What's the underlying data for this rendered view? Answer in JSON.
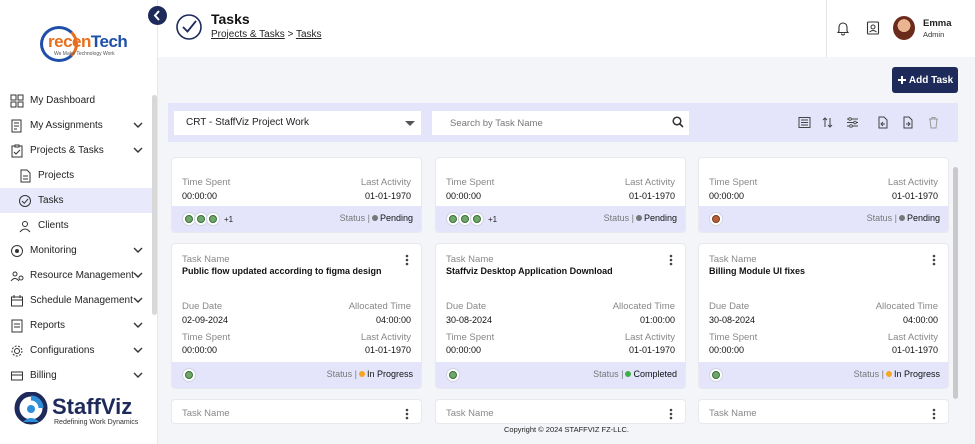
{
  "company_logo": {
    "name": "recenTech",
    "name_a": "recen",
    "name_b": "Tech",
    "tagline": "We Make Technology Work"
  },
  "sidebar": {
    "items": [
      {
        "label": "My Dashboard",
        "icon": "dashboard-icon",
        "has_children": false,
        "sub": false,
        "active": false
      },
      {
        "label": "My Assignments",
        "icon": "assignments-icon",
        "has_children": true,
        "sub": false,
        "active": false
      },
      {
        "label": "Projects & Tasks",
        "icon": "clipboard-icon",
        "has_children": true,
        "sub": false,
        "active": false
      },
      {
        "label": "Projects",
        "icon": "projects-icon",
        "has_children": false,
        "sub": true,
        "active": false
      },
      {
        "label": "Tasks",
        "icon": "check-circle-icon",
        "has_children": false,
        "sub": true,
        "active": true
      },
      {
        "label": "Clients",
        "icon": "clients-icon",
        "has_children": false,
        "sub": true,
        "active": false
      },
      {
        "label": "Monitoring",
        "icon": "monitoring-icon",
        "has_children": true,
        "sub": false,
        "active": false
      },
      {
        "label": "Resource Management",
        "icon": "resource-icon",
        "has_children": true,
        "sub": false,
        "active": false
      },
      {
        "label": "Schedule Management",
        "icon": "schedule-icon",
        "has_children": true,
        "sub": false,
        "active": false
      },
      {
        "label": "Reports",
        "icon": "reports-icon",
        "has_children": true,
        "sub": false,
        "active": false
      },
      {
        "label": "Configurations",
        "icon": "gear-icon",
        "has_children": true,
        "sub": false,
        "active": false
      },
      {
        "label": "Billing",
        "icon": "billing-icon",
        "has_children": true,
        "sub": false,
        "active": false
      }
    ]
  },
  "brand": {
    "name": "StaffViz",
    "tagline": "Redefining Work Dynamics"
  },
  "header": {
    "title": "Tasks",
    "breadcrumb": [
      "Projects & Tasks",
      "Tasks"
    ],
    "breadcrumb_sep": ">",
    "user": {
      "name": "Emma",
      "role": "Admin"
    }
  },
  "actions": {
    "add_task": "Add Task"
  },
  "toolbar": {
    "project_select": "CRT - StaffViz Project Work",
    "search_placeholder": "Search by Task Name"
  },
  "labels": {
    "task_name": "Task Name",
    "due_date": "Due Date",
    "allocated_time": "Allocated Time",
    "time_spent": "Time Spent",
    "last_activity": "Last Activity",
    "status": "Status |"
  },
  "cards_top": [
    {
      "time_spent": "00:00:00",
      "last_activity": "01-01-1970",
      "status": "Pending",
      "status_color": "#777777",
      "avatars": 3,
      "more": "+1"
    },
    {
      "time_spent": "00:00:00",
      "last_activity": "01-01-1970",
      "status": "Pending",
      "status_color": "#777777",
      "avatars": 3,
      "more": "+1"
    },
    {
      "time_spent": "00:00:00",
      "last_activity": "01-01-1970",
      "status": "Pending",
      "status_color": "#777777",
      "avatars": 1,
      "more": ""
    }
  ],
  "cards": [
    {
      "task_name": "Public flow updated according to figma design",
      "due_date": "02-09-2024",
      "allocated_time": "04:00:00",
      "time_spent": "00:00:00",
      "last_activity": "01-01-1970",
      "status": "In Progress",
      "status_color": "#f5a623"
    },
    {
      "task_name": "Staffviz Desktop Application Download",
      "due_date": "30-08-2024",
      "allocated_time": "01:00:00",
      "time_spent": "00:00:00",
      "last_activity": "01-01-1970",
      "status": "Completed",
      "status_color": "#3cb043"
    },
    {
      "task_name": "Billing Module UI fixes",
      "due_date": "30-08-2024",
      "allocated_time": "04:00:00",
      "time_spent": "00:00:00",
      "last_activity": "01-01-1970",
      "status": "In Progress",
      "status_color": "#f5a623"
    }
  ],
  "footer": {
    "copyright": "Copyright © 2024 STAFFVIZ FZ-LLC."
  }
}
